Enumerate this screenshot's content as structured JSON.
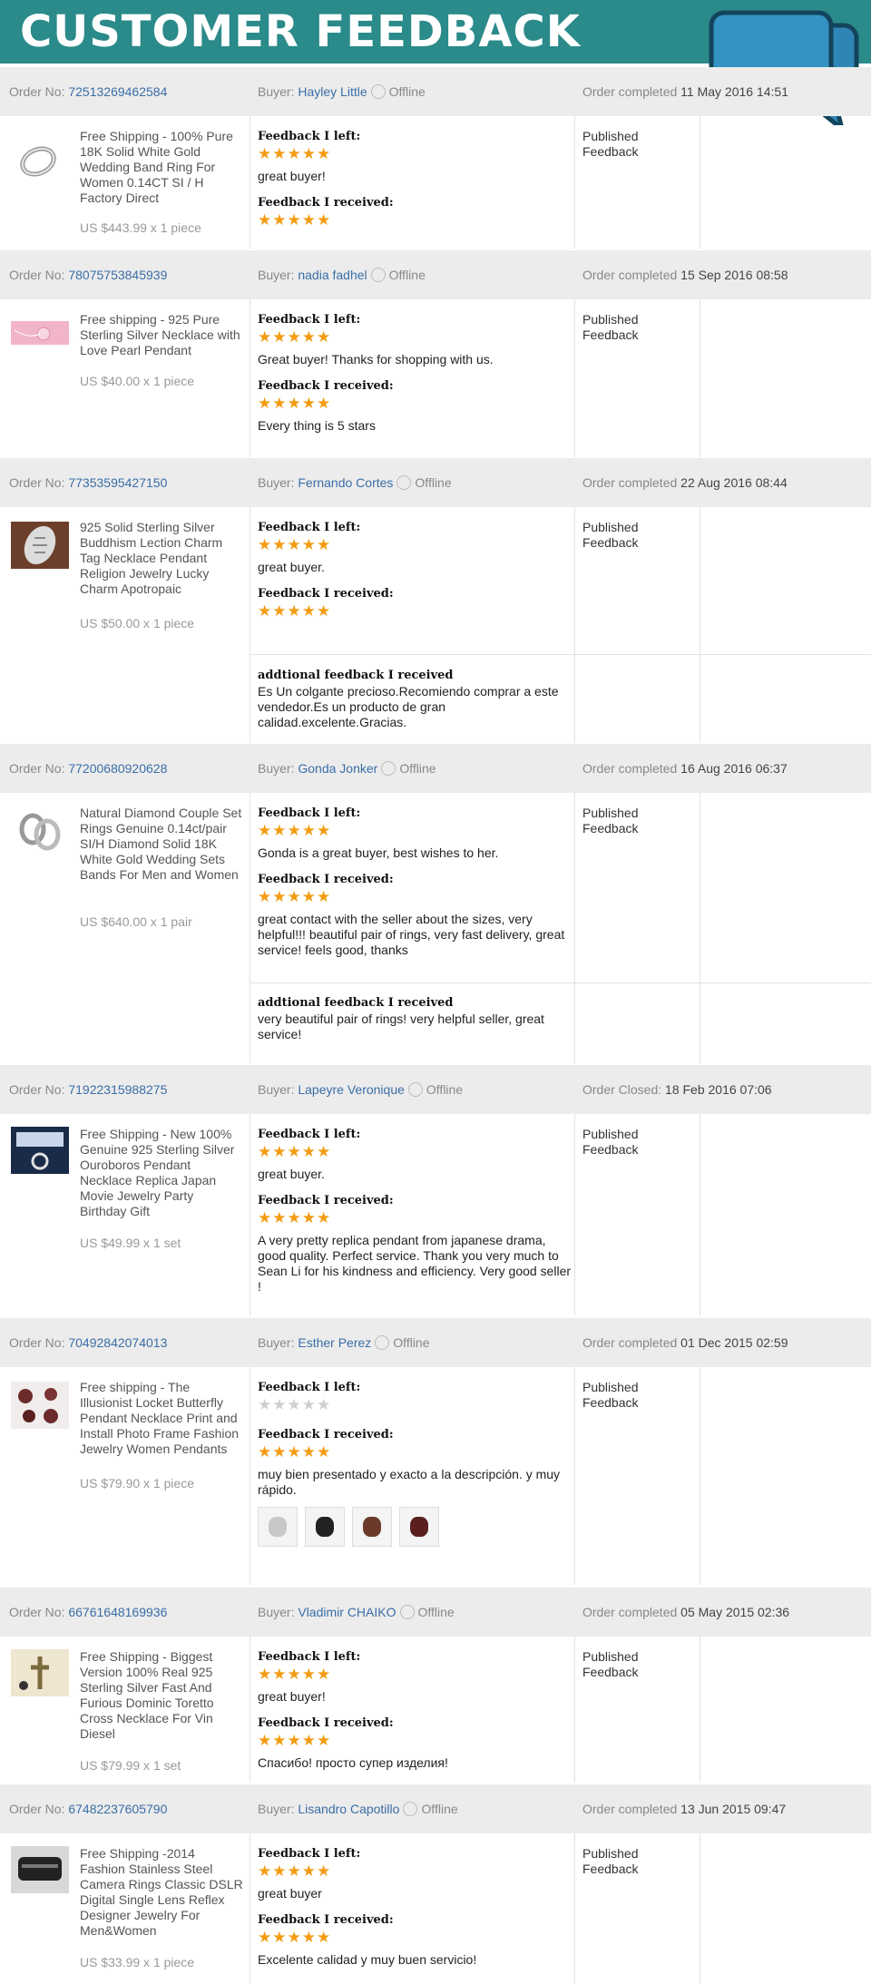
{
  "banner": {
    "title": "CUSTOMER FEEDBACK"
  },
  "labels": {
    "order_no": "Order No:",
    "buyer": "Buyer:",
    "feedback_left": "Feedback I left:",
    "feedback_received": "Feedback I received:",
    "additional_received": "addtional feedback I received"
  },
  "orders": [
    {
      "order_no": "72513269462584",
      "buyer_name": "Hayley Little",
      "buyer_status": "Offline",
      "status_label": "Order completed",
      "status_date": "11 May 2016 14:51",
      "product_title": "Free Shipping - 100% Pure 18K Solid White Gold Wedding Band Ring For Women 0.14CT SI / H Factory Direct",
      "price": "US $443.99 x 1 piece",
      "left_stars": "★★★★★",
      "left_text": "great buyer!",
      "received_stars": "★★★★★",
      "received_text": "",
      "published": "Published Feedback"
    },
    {
      "order_no": "78075753845939",
      "buyer_name": "nadia fadhel",
      "buyer_status": "Offline",
      "status_label": "Order completed",
      "status_date": "15 Sep 2016 08:58",
      "product_title": "Free shipping - 925 Pure Sterling Silver Necklace with Love Pearl Pendant",
      "price": "US $40.00 x 1 piece",
      "left_stars": "★★★★★",
      "left_text": "Great buyer! Thanks for shopping with us.",
      "received_stars": "★★★★★",
      "received_text": "Every thing is 5 stars",
      "published": "Published Feedback"
    },
    {
      "order_no": "77353595427150",
      "buyer_name": "Fernando Cortes",
      "buyer_status": "Offline",
      "status_label": "Order completed",
      "status_date": "22 Aug 2016 08:44",
      "product_title": "925 Solid Sterling Silver Buddhism Lection Charm Tag Necklace Pendant Religion Jewelry Lucky Charm Apotropaic",
      "price": "US $50.00 x 1 piece",
      "left_stars": "★★★★★",
      "left_text": "great buyer.",
      "received_stars": "★★★★★",
      "received_text": "",
      "additional": "Es Un colgante precioso.Recomiendo comprar a este vendedor.Es un producto de gran calidad.excelente.Gracias.",
      "published": "Published Feedback"
    },
    {
      "order_no": "77200680920628",
      "buyer_name": "Gonda Jonker",
      "buyer_status": "Offline",
      "status_label": "Order completed",
      "status_date": "16 Aug 2016 06:37",
      "product_title": "Natural Diamond Couple Set Rings Genuine 0.14ct/pair SI/H Diamond Solid 18K White Gold Wedding Sets Bands For Men and Women",
      "price": "US $640.00 x 1 pair",
      "left_stars": "★★★★★",
      "left_text": "Gonda is a great buyer, best wishes to her.",
      "received_stars": "★★★★★",
      "received_text": "great contact with the seller about the sizes, very helpful!!! beautiful pair of rings, very fast delivery, great service! feels good, thanks",
      "additional": "very beautiful pair of rings! very helpful seller, great service!",
      "published": "Published Feedback"
    },
    {
      "order_no": "71922315988275",
      "buyer_name": "Lapeyre Veronique",
      "buyer_status": "Offline",
      "status_label": "Order Closed:",
      "status_date": "18 Feb 2016 07:06",
      "product_title": "Free Shipping - New 100% Genuine 925 Sterling Silver Ouroboros Pendant Necklace Replica Japan Movie Jewelry Party Birthday Gift",
      "price": "US $49.99 x 1 set",
      "left_stars": "★★★★★",
      "left_text": "great buyer.",
      "received_stars": "★★★★★",
      "received_text": "A very pretty replica pendant from japanese drama, good quality. Perfect service. Thank you very much to Sean Li for his kindness and efficiency. Very good seller !",
      "published": "Published Feedback"
    },
    {
      "order_no": "70492842074013",
      "buyer_name": "Esther Perez",
      "buyer_status": "Offline",
      "status_label": "Order completed",
      "status_date": "01 Dec 2015 02:59",
      "product_title": "Free shipping - The Illusionist Locket Butterfly Pendant Necklace Print and Install Photo Frame Fashion Jewelry Women Pendants",
      "price": "US $79.90 x 1 piece",
      "left_stars": "★★★★★",
      "left_text": "",
      "received_stars": "★★★★★",
      "received_text": "muy bien presentado y exacto a la descripción. y muy rápido.",
      "published": "Published Feedback"
    },
    {
      "order_no": "66761648169936",
      "buyer_name": "Vladimir CHAIKO",
      "buyer_status": "Offline",
      "status_label": "Order completed",
      "status_date": "05 May 2015 02:36",
      "product_title": "Free Shipping - Biggest Version 100% Real 925 Sterling Silver Fast And Furious Dominic Toretto Cross Necklace For Vin Diesel",
      "price": "US $79.99 x 1 set",
      "left_stars": "★★★★★",
      "left_text": "great buyer!",
      "received_stars": "★★★★★",
      "received_text": "Спасибо! просто супер изделия!",
      "published": "Published Feedback"
    },
    {
      "order_no": "67482237605790",
      "buyer_name": "Lisandro Capotillo",
      "buyer_status": "Offline",
      "status_label": "Order completed",
      "status_date": "13 Jun 2015 09:47",
      "product_title": "Free Shipping -2014 Fashion Stainless Steel Camera Rings Classic DSLR Digital Single Lens Reflex Designer Jewelry For Men&Women",
      "price": "US $33.99 x 1 piece",
      "left_stars": "★★★★★",
      "left_text": "great buyer",
      "received_stars": "★★★★★",
      "received_text": "Excelente calidad y muy buen servicio!",
      "published": "Published Feedback"
    }
  ]
}
